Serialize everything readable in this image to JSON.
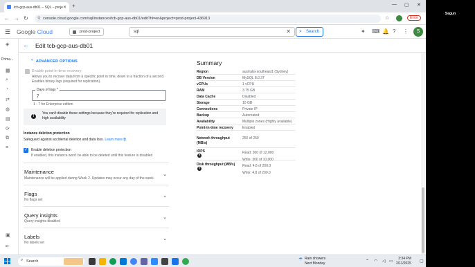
{
  "browser": {
    "tab_title": "tcb-gcp-aus-db01 – SQL – proje",
    "url": "console.cloud.google.com/sql/instances/tcb-gcp-aus-db01/edit?hl=en&project=prod-project-436913",
    "error_label": "Error"
  },
  "header": {
    "logo_google": "Google",
    "logo_cloud": "Cloud",
    "project": "prod-project",
    "search_value": "sql",
    "search_button": "Search",
    "avatar_letter": "S"
  },
  "rail": {
    "label": "Prima..."
  },
  "page": {
    "title": "Edit tcb-gcp-aus-db01"
  },
  "advanced": {
    "toggle_label": "ADVANCED OPTIONS",
    "pitr_label": "Enable point-in-time recovery",
    "pitr_help": "Allows you to recover data from a specific point in time, down to a fraction of a second. Enables binary logs (required for replication).",
    "days_label": "Days of logs *",
    "days_value": "7",
    "days_hint": "1 - 7 for Enterprise edition",
    "note": "You can't disable these settings because they're required for replication and high availability",
    "deletion_title": "Instance deletion protection",
    "deletion_desc": "Safeguard against accidental deletion and data loss.",
    "learn_more": "Learn more",
    "deletion_cb_label": "Enable deletion protection",
    "deletion_cb_help": "If enabled, this instance won't be able to be deleted until this feature is disabled"
  },
  "sections": [
    {
      "title": "Maintenance",
      "subtitle": "Maintenance will be applied during Week 2. Updates may occur any day of the week."
    },
    {
      "title": "Flags",
      "subtitle": "No flags set"
    },
    {
      "title": "Query insights",
      "subtitle": "Query insights disabled"
    },
    {
      "title": "Labels",
      "subtitle": "No labels set"
    }
  ],
  "summary": {
    "title": "Summary",
    "rows": [
      {
        "key": "Region",
        "value": "australia-southeast1 (Sydney)"
      },
      {
        "key": "DB Version",
        "value": "MySQL 8.0.37"
      },
      {
        "key": "vCPUs",
        "value": "1 vCPU"
      },
      {
        "key": "RAM",
        "value": "3.75 GB"
      },
      {
        "key": "Data Cache",
        "value": "Disabled"
      },
      {
        "key": "Storage",
        "value": "10 GB"
      },
      {
        "key": "Connections",
        "value": "Private IP"
      },
      {
        "key": "Backup",
        "value": "Automated"
      },
      {
        "key": "Availability",
        "value": "Multiple zones (Highly available)"
      },
      {
        "key": "Point-in-time recovery",
        "value": "Enabled"
      }
    ],
    "network_key": "Network throughput",
    "network_unit": "(MB/s)",
    "network_value": "250 of 250",
    "iops_key": "IOPS",
    "iops_read": "Read: 300 of 12,000",
    "iops_write": "Write: 300 of 10,000",
    "disk_key": "Disk throughput (MB/s)",
    "disk_read": "Read: 4.8 of 200.0",
    "disk_write": "Write: 4.8 of 200.0"
  },
  "taskbar": {
    "search_placeholder": "Search",
    "weather_title": "Rain showers",
    "weather_sub": "Next Monday",
    "time": "3:34 PM",
    "date": "2/11/2025"
  },
  "side": {
    "user": "Segun"
  }
}
